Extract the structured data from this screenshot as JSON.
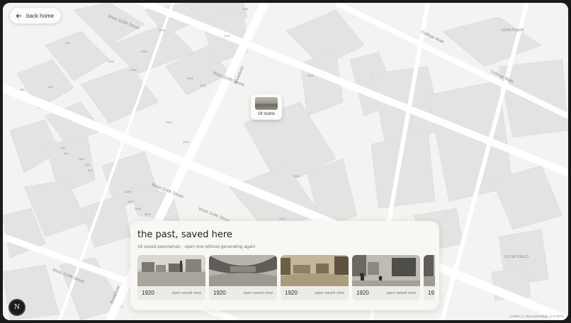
{
  "back_button": {
    "label": "back home",
    "icon": "arrow-left-icon"
  },
  "marker": {
    "count_label": "16 scans"
  },
  "map_labels": {
    "streets": [
      "West 115th Street",
      "West 115th Street",
      "West 114th Street",
      "West 114th Street",
      "West 113th Street",
      "Broadway",
      "Broadway",
      "College Walk",
      "College Walk"
    ],
    "places": [
      "LOW PLAZA",
      "CU SE FIELD"
    ],
    "buildings": [
      "2951",
      "2941",
      "2923",
      "2915",
      "2907",
      "2901",
      "2900",
      "2920",
      "2924",
      "2936",
      "2940",
      "2944",
      "2950",
      "535",
      "540",
      "545",
      "612",
      "614",
      "616",
      "618",
      "620",
      "2855",
      "2847",
      "2845",
      "2839"
    ]
  },
  "panel": {
    "title": "the past, saved here",
    "subtitle": "16 saved panoramas · open one without generating again",
    "cards": [
      {
        "year": "1920",
        "action": "open saved view"
      },
      {
        "year": "1920",
        "action": "open saved view"
      },
      {
        "year": "1920",
        "action": "open saved view"
      },
      {
        "year": "1920",
        "action": "open saved view"
      },
      {
        "year": "19",
        "action": ""
      }
    ]
  },
  "badge": {
    "letter": "N"
  },
  "attribution": "Leaflet | © OpenStreetMap, © CARTO",
  "colors": {
    "map_bg": "#f3f3f1",
    "building": "#e2e2e0",
    "road": "#ffffff",
    "panel_bg": "#f8f7f3",
    "sepia": "#8e8b80"
  }
}
